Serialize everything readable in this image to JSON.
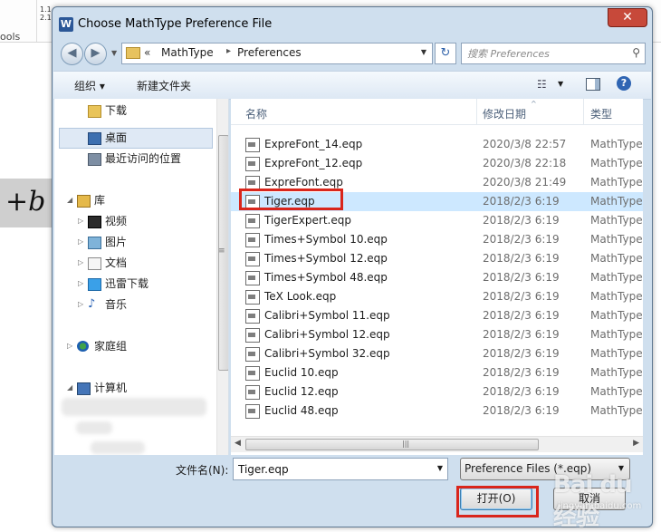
{
  "background": {
    "tools_label": "ools",
    "numbers": [
      "1.1",
      "2.1"
    ],
    "equation_fragment": "+b"
  },
  "dialog": {
    "title": "Choose MathType Preference File",
    "app_icon": "W",
    "close_label": "✕"
  },
  "address": {
    "prefix": "«",
    "crumbs": [
      "MathType",
      "Preferences"
    ],
    "separator": "▸"
  },
  "search": {
    "placeholder": "搜索 Preferences"
  },
  "toolbar": {
    "organize": "组织 ▾",
    "new_folder": "新建文件夹"
  },
  "nav": {
    "items": [
      {
        "label": "下载",
        "icon": "downloads-icon"
      },
      {
        "label": "桌面",
        "icon": "desktop-icon"
      },
      {
        "label": "最近访问的位置",
        "icon": "recent-places-icon"
      },
      {
        "label": "库",
        "icon": "libraries-icon"
      },
      {
        "label": "视频",
        "icon": "videos-icon"
      },
      {
        "label": "图片",
        "icon": "pictures-icon"
      },
      {
        "label": "文档",
        "icon": "documents-icon"
      },
      {
        "label": "迅雷下载",
        "icon": "thunder-download-icon"
      },
      {
        "label": "音乐",
        "icon": "music-icon"
      },
      {
        "label": "家庭组",
        "icon": "homegroup-icon"
      },
      {
        "label": "计算机",
        "icon": "computer-icon"
      }
    ]
  },
  "columns": {
    "name": "名称",
    "date": "修改日期",
    "type": "类型"
  },
  "files": [
    {
      "name": "ExpreFont_14.eqp",
      "date": "2020/3/8 22:57",
      "type": "MathType"
    },
    {
      "name": "ExpreFont_12.eqp",
      "date": "2020/3/8 22:18",
      "type": "MathType"
    },
    {
      "name": "ExpreFont.eqp",
      "date": "2020/3/8 21:49",
      "type": "MathType"
    },
    {
      "name": "Tiger.eqp",
      "date": "2018/2/3 6:19",
      "type": "MathType"
    },
    {
      "name": "TigerExpert.eqp",
      "date": "2018/2/3 6:19",
      "type": "MathType"
    },
    {
      "name": "Times+Symbol 10.eqp",
      "date": "2018/2/3 6:19",
      "type": "MathType"
    },
    {
      "name": "Times+Symbol 12.eqp",
      "date": "2018/2/3 6:19",
      "type": "MathType"
    },
    {
      "name": "Times+Symbol 48.eqp",
      "date": "2018/2/3 6:19",
      "type": "MathType"
    },
    {
      "name": "TeX Look.eqp",
      "date": "2018/2/3 6:19",
      "type": "MathType"
    },
    {
      "name": "Calibri+Symbol 11.eqp",
      "date": "2018/2/3 6:19",
      "type": "MathType"
    },
    {
      "name": "Calibri+Symbol 12.eqp",
      "date": "2018/2/3 6:19",
      "type": "MathType"
    },
    {
      "name": "Calibri+Symbol 32.eqp",
      "date": "2018/2/3 6:19",
      "type": "MathType"
    },
    {
      "name": "Euclid 10.eqp",
      "date": "2018/2/3 6:19",
      "type": "MathType"
    },
    {
      "name": "Euclid 12.eqp",
      "date": "2018/2/3 6:19",
      "type": "MathType"
    },
    {
      "name": "Euclid 48.eqp",
      "date": "2018/2/3 6:19",
      "type": "MathType"
    }
  ],
  "selected_index": 3,
  "bottom": {
    "filename_label": "文件名(N):",
    "filename_value": "Tiger.eqp",
    "filter": "Preference Files (*.eqp)",
    "open_label": "打开(O)",
    "cancel_label": "取消"
  },
  "watermark": {
    "main": "Bai du 经验",
    "sub": "jingyan.baidu.com"
  },
  "colors": {
    "highlight": "#d9261c",
    "selection": "#cde8ff",
    "frame": "#cfdfee"
  }
}
